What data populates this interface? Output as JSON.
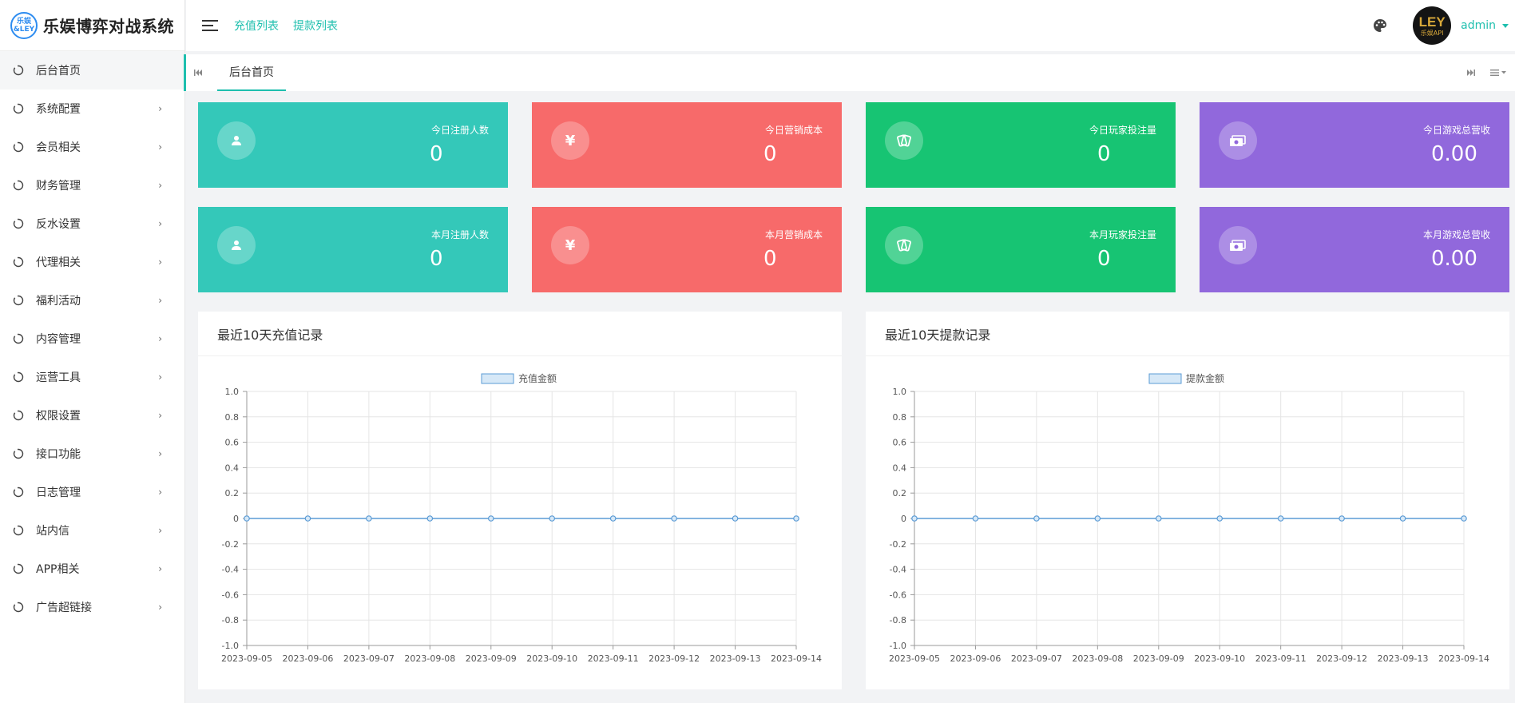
{
  "brand": {
    "logo_mark_line1": "乐娱",
    "logo_mark_line2": "&LEY",
    "name": "乐娱博弈对战系统"
  },
  "sidebar": {
    "items": [
      {
        "label": "后台首页",
        "has_arrow": false,
        "active": true
      },
      {
        "label": "系统配置",
        "has_arrow": true
      },
      {
        "label": "会员相关",
        "has_arrow": true
      },
      {
        "label": "财务管理",
        "has_arrow": true
      },
      {
        "label": "反水设置",
        "has_arrow": true
      },
      {
        "label": "代理相关",
        "has_arrow": true
      },
      {
        "label": "福利活动",
        "has_arrow": true
      },
      {
        "label": "内容管理",
        "has_arrow": true
      },
      {
        "label": "运营工具",
        "has_arrow": true
      },
      {
        "label": "权限设置",
        "has_arrow": true
      },
      {
        "label": "接口功能",
        "has_arrow": true
      },
      {
        "label": "日志管理",
        "has_arrow": true
      },
      {
        "label": "站内信",
        "has_arrow": true
      },
      {
        "label": "APP相关",
        "has_arrow": true
      },
      {
        "label": "广告超链接",
        "has_arrow": true
      }
    ],
    "arrow_glyph": "›"
  },
  "header": {
    "links": [
      "充值列表",
      "提款列表"
    ],
    "user": {
      "name": "admin",
      "avatar_text_big": "LEY",
      "avatar_text_small": "乐娱API"
    }
  },
  "tabs": {
    "items": [
      "后台首页"
    ]
  },
  "colors": {
    "accent": "#1ebfae",
    "teal": "#34c8b9",
    "red": "#f76a6a",
    "green": "#17c473",
    "purple": "#9168dc"
  },
  "stats": {
    "row1": [
      {
        "label": "今日注册人数",
        "value": "0",
        "icon": "user-icon",
        "icon_glyph": "",
        "color": "#34c8b9"
      },
      {
        "label": "今日营销成本",
        "value": "0",
        "icon": "yuan-icon",
        "icon_glyph": "¥",
        "color": "#f76a6a"
      },
      {
        "label": "今日玩家投注量",
        "value": "0",
        "icon": "cards-icon",
        "icon_glyph": "",
        "color": "#17c473"
      },
      {
        "label": "今日游戏总营收",
        "value": "0.00",
        "icon": "money-icon",
        "icon_glyph": "",
        "color": "#9168dc"
      }
    ],
    "row2": [
      {
        "label": "本月注册人数",
        "value": "0",
        "icon": "user-icon",
        "icon_glyph": "",
        "color": "#34c8b9"
      },
      {
        "label": "本月营销成本",
        "value": "0",
        "icon": "yuan-icon",
        "icon_glyph": "¥",
        "color": "#f76a6a"
      },
      {
        "label": "本月玩家投注量",
        "value": "0",
        "icon": "cards-icon",
        "icon_glyph": "",
        "color": "#17c473"
      },
      {
        "label": "本月游戏总营收",
        "value": "0.00",
        "icon": "money-icon",
        "icon_glyph": "",
        "color": "#9168dc"
      }
    ]
  },
  "panels": [
    {
      "title": "最近10天充值记录"
    },
    {
      "title": "最近10天提款记录"
    }
  ],
  "chart_data": [
    {
      "type": "line",
      "title": "",
      "x": [
        "2023-09-05",
        "2023-09-06",
        "2023-09-07",
        "2023-09-08",
        "2023-09-09",
        "2023-09-10",
        "2023-09-11",
        "2023-09-12",
        "2023-09-13",
        "2023-09-14"
      ],
      "series": [
        {
          "name": "充值金额",
          "values": [
            0,
            0,
            0,
            0,
            0,
            0,
            0,
            0,
            0,
            0
          ],
          "color": "#5b9bd5"
        }
      ],
      "yticks": [
        "1.0",
        "0.8",
        "0.6",
        "0.4",
        "0.2",
        "0",
        "-0.2",
        "-0.4",
        "-0.6",
        "-0.8",
        "-1.0"
      ],
      "ylim": [
        -1.0,
        1.0
      ],
      "grid": true,
      "legend": "top-center"
    },
    {
      "type": "line",
      "title": "",
      "x": [
        "2023-09-05",
        "2023-09-06",
        "2023-09-07",
        "2023-09-08",
        "2023-09-09",
        "2023-09-10",
        "2023-09-11",
        "2023-09-12",
        "2023-09-13",
        "2023-09-14"
      ],
      "series": [
        {
          "name": "提款金额",
          "values": [
            0,
            0,
            0,
            0,
            0,
            0,
            0,
            0,
            0,
            0
          ],
          "color": "#5b9bd5"
        }
      ],
      "yticks": [
        "1.0",
        "0.8",
        "0.6",
        "0.4",
        "0.2",
        "0",
        "-0.2",
        "-0.4",
        "-0.6",
        "-0.8",
        "-1.0"
      ],
      "ylim": [
        -1.0,
        1.0
      ],
      "grid": true,
      "legend": "top-center"
    }
  ]
}
